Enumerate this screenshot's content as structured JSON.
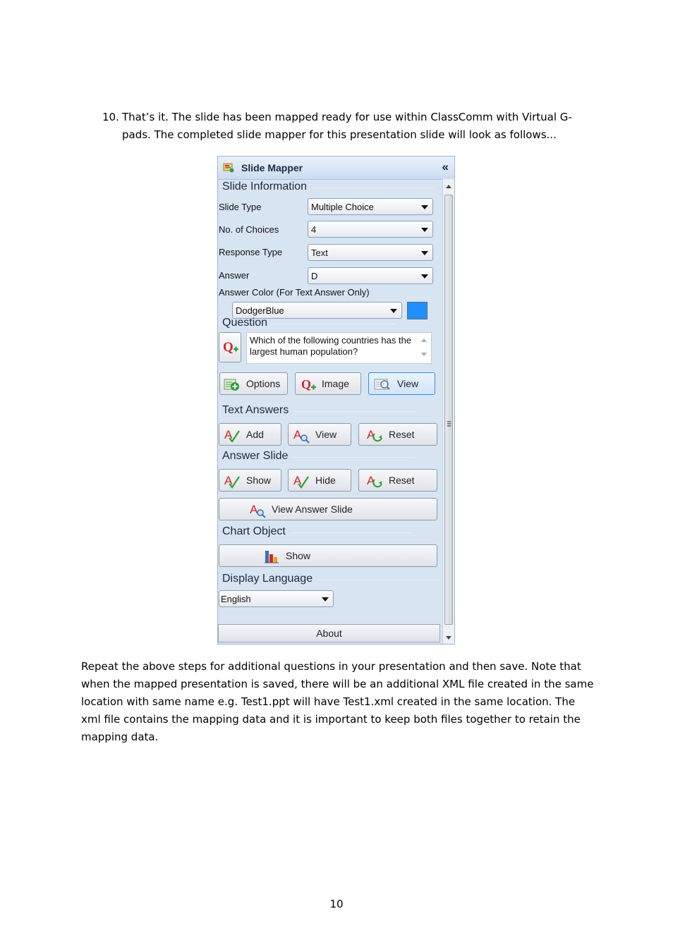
{
  "step": {
    "number": "10.",
    "text": "That’s it.  The slide has been mapped ready for use within ClassComm with Virtual G-pads. The completed slide mapper for this presentation slide will look as follows..."
  },
  "panel": {
    "title": "Slide Mapper",
    "collapse_glyph": "«",
    "slide_information": {
      "heading": "Slide Information",
      "slide_type_label": "Slide Type",
      "slide_type_value": "Multiple Choice",
      "choices_label": "No. of Choices",
      "choices_value": "4",
      "response_type_label": "Response Type",
      "response_type_value": "Text",
      "answer_label": "Answer",
      "answer_value": "D",
      "answer_color_label": "Answer Color (For Text Answer Only)",
      "answer_color_value": "DodgerBlue",
      "answer_color_hex": "#1e90ff"
    },
    "question": {
      "heading": "Question",
      "text": "Which of the following countries has the largest human population?",
      "options_label": "Options",
      "image_label": "Image",
      "view_label": "View"
    },
    "text_answers": {
      "heading": "Text Answers",
      "add_label": "Add",
      "view_label": "View",
      "reset_label": "Reset"
    },
    "answer_slide": {
      "heading": "Answer Slide",
      "show_label": "Show",
      "hide_label": "Hide",
      "reset_label": "Reset",
      "view_answer_label": "View Answer Slide"
    },
    "chart_object": {
      "heading": "Chart Object",
      "show_label": "Show"
    },
    "display_language": {
      "heading": "Display Language",
      "value": "English"
    },
    "about_label": "About"
  },
  "paragraph": "Repeat the above steps for additional questions in your presentation and then save.  Note that when the mapped presentation is saved, there will be an additional XML file created in the same location with same name e.g. Test1.ppt will have Test1.xml created in the same location.  The xml file contains the mapping data and it is important to keep both files together to retain the mapping data.",
  "page_number": "10",
  "colors": {
    "panel_bg": "#d7e4f2",
    "accent_red": "#d8232a",
    "accent_green": "#2e9e3a"
  }
}
